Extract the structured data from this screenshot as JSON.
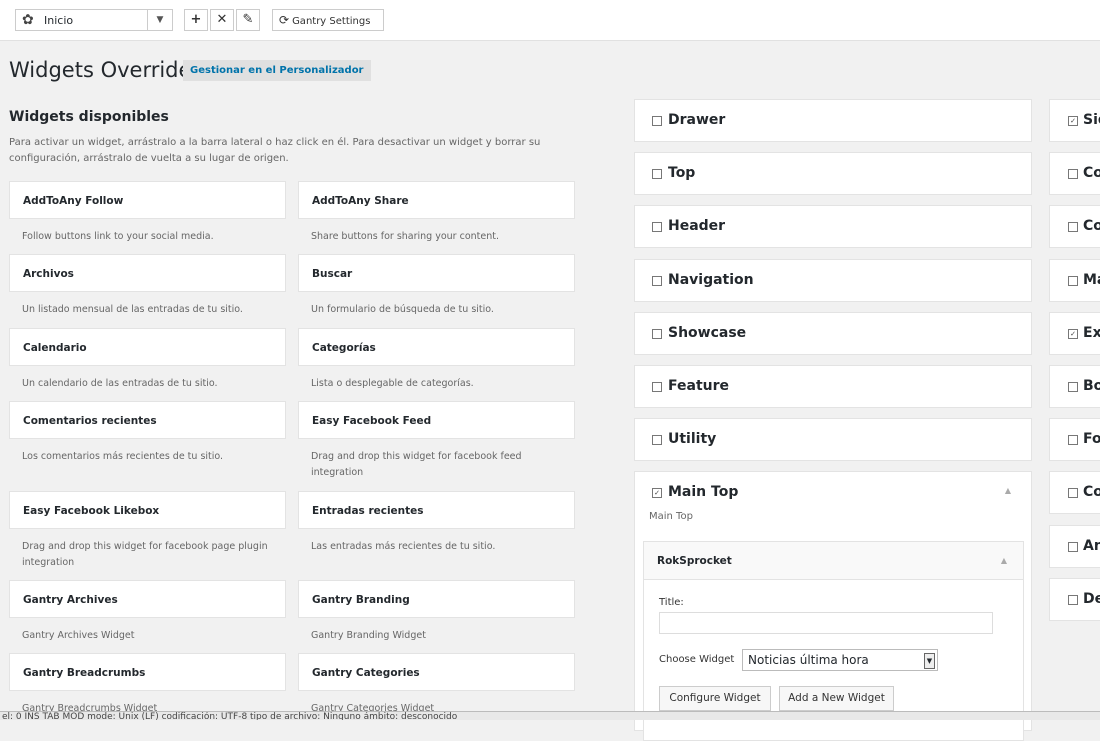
{
  "toolbar": {
    "select_value": "Inicio",
    "gear_icon": "gear-icon",
    "add_icon": "plus-icon",
    "delete_icon": "close-icon",
    "edit_icon": "pencil-icon",
    "gantry_settings_label": "Gantry Settings"
  },
  "page": {
    "title": "Widgets Override",
    "manage_button": "Gestionar en el Personalizador"
  },
  "available": {
    "title": "Widgets disponibles",
    "description": "Para activar un widget, arrástralo a la barra lateral o haz click en él. Para desactivar un widget y borrar su configuración, arrástralo de vuelta a su lugar de origen.",
    "widgets": [
      {
        "name": "AddToAny Follow",
        "desc": "Follow buttons link to your social media."
      },
      {
        "name": "AddToAny Share",
        "desc": "Share buttons for sharing your content."
      },
      {
        "name": "Archivos",
        "desc": "Un listado mensual de las entradas de tu sitio."
      },
      {
        "name": "Buscar",
        "desc": "Un formulario de búsqueda de tu sitio."
      },
      {
        "name": "Calendario",
        "desc": "Un calendario de las entradas de tu sitio."
      },
      {
        "name": "Categorías",
        "desc": "Lista o desplegable de categorías."
      },
      {
        "name": "Comentarios recientes",
        "desc": "Los comentarios más recientes de tu sitio."
      },
      {
        "name": "Easy Facebook Feed",
        "desc": "Drag and drop this widget for facebook feed integration"
      },
      {
        "name": "Easy Facebook Likebox",
        "desc": "Drag and drop this widget for facebook page plugin integration"
      },
      {
        "name": "Entradas recientes",
        "desc": "Las entradas más recientes de tu sitio."
      },
      {
        "name": "Gantry Archives",
        "desc": "Gantry Archives Widget"
      },
      {
        "name": "Gantry Branding",
        "desc": "Gantry Branding Widget"
      },
      {
        "name": "Gantry Breadcrumbs",
        "desc": "Gantry Breadcrumbs Widget"
      },
      {
        "name": "Gantry Categories",
        "desc": "Gantry Categories Widget"
      }
    ]
  },
  "areas": [
    {
      "name": "Drawer",
      "checked": false
    },
    {
      "name": "Top",
      "checked": false
    },
    {
      "name": "Header",
      "checked": false
    },
    {
      "name": "Navigation",
      "checked": false
    },
    {
      "name": "Showcase",
      "checked": false
    },
    {
      "name": "Feature",
      "checked": false
    },
    {
      "name": "Utility",
      "checked": false
    }
  ],
  "main_top": {
    "name": "Main Top",
    "checked": true,
    "description": "Main Top",
    "widget": {
      "name": "RokSprocket",
      "title_label": "Title:",
      "title_value": "",
      "choose_label": "Choose Widget",
      "choose_value": "Noticias última hora",
      "configure_button": "Configure Widget",
      "add_button": "Add a New Widget"
    }
  },
  "right_areas": [
    {
      "name": "Sid",
      "checked": true
    },
    {
      "name": "Co",
      "checked": false
    },
    {
      "name": "Co",
      "checked": false
    },
    {
      "name": "Ma",
      "checked": false
    },
    {
      "name": "Ex",
      "checked": true
    },
    {
      "name": "Bo",
      "checked": false
    },
    {
      "name": "Fo",
      "checked": false
    },
    {
      "name": "Co",
      "checked": false
    },
    {
      "name": "An",
      "checked": false
    },
    {
      "name": "De",
      "checked": false
    }
  ],
  "statusbar": {
    "text": "el: 0      INS    TAB    MOD     mode: Unix (LF)     codificación: UTF-8     tipo de archivo: Ninguno     ámbito: desconocido"
  }
}
